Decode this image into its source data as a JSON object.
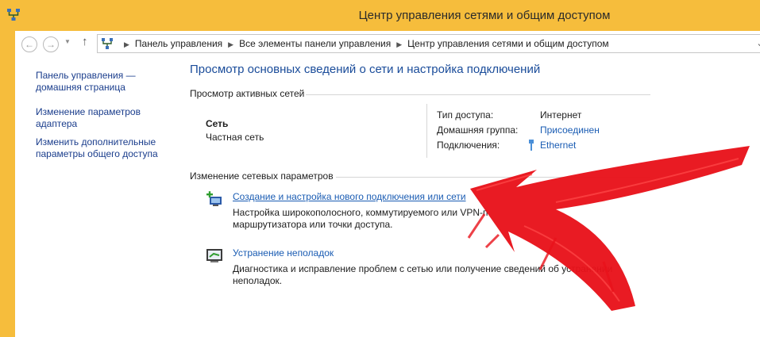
{
  "window": {
    "title": "Центр управления сетями и общим доступом"
  },
  "address": {
    "breadcrumbs": [
      "Панель управления",
      "Все элементы панели управления",
      "Центр управления сетями и общим доступом"
    ]
  },
  "sidebar": {
    "items": [
      {
        "label_line1": "Панель управления —",
        "label_line2": "домашняя страница"
      },
      {
        "label_line1": "Изменение параметров",
        "label_line2": "адаптера"
      },
      {
        "label_line1": "Изменить дополнительные",
        "label_line2": "параметры общего доступа"
      }
    ]
  },
  "main": {
    "title": "Просмотр основных сведений о сети и настройка подключений",
    "active_networks": {
      "heading": "Просмотр активных сетей",
      "network_name": "Сеть",
      "network_type": "Частная сеть",
      "details": [
        {
          "label": "Тип доступа:",
          "value": "Интернет",
          "is_link": false
        },
        {
          "label": "Домашняя группа:",
          "value": "Присоединен",
          "is_link": true
        },
        {
          "label": "Подключения:",
          "value": "Ethernet",
          "is_link": true,
          "icon": "ethernet-icon"
        }
      ]
    },
    "change_settings": {
      "heading": "Изменение сетевых параметров",
      "tasks": [
        {
          "link": "Создание и настройка нового подключения или сети",
          "desc_line1": "Настройка широкополосного, коммутируемого или VPN-п",
          "desc_line2": "маршрутизатора или точки доступа.",
          "icon": "new-connection-icon"
        },
        {
          "link": "Устранение неполадок",
          "desc_line1": "Диагностика и исправление проблем с сетью или получение сведений об устранении",
          "desc_line2": "неполадок.",
          "icon": "troubleshoot-icon"
        }
      ]
    }
  },
  "colors": {
    "titlebar": "#f6bd3c",
    "title_blue": "#1a4c9a",
    "link_blue": "#1a5cb3",
    "annotation_red": "#e8121a"
  }
}
